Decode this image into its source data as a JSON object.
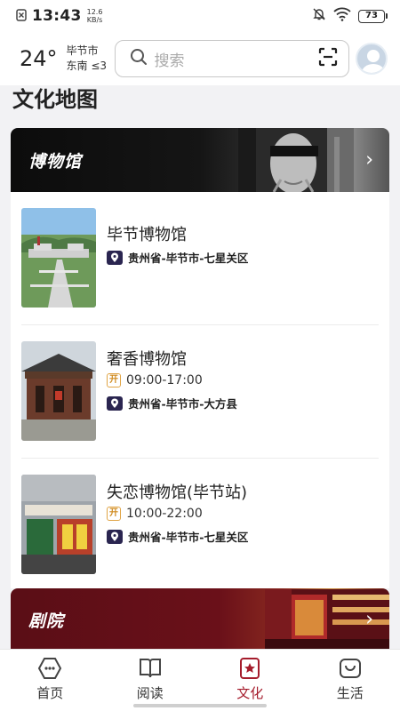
{
  "status_bar": {
    "time": "13:43",
    "net_speed_value": "12.6",
    "net_speed_unit": "KB/s",
    "battery": "73"
  },
  "header": {
    "temperature": "24°",
    "city": "毕节市",
    "wind": "东南 ≤3",
    "search_placeholder": "搜索"
  },
  "page": {
    "title": "文化地图"
  },
  "sections": [
    {
      "title": "博物馆",
      "items": [
        {
          "name": "毕节博物馆",
          "hours": "",
          "address": "贵州省-毕节市-七星关区"
        },
        {
          "name": "奢香博物馆",
          "hours": "09:00-17:00",
          "address": "贵州省-毕节市-大方县"
        },
        {
          "name": "失恋博物馆(毕节站)",
          "hours": "10:00-22:00",
          "address": "贵州省-毕节市-七星关区"
        }
      ]
    },
    {
      "title": "剧院"
    }
  ],
  "open_badge": "开",
  "tabs": [
    {
      "label": "首页"
    },
    {
      "label": "阅读"
    },
    {
      "label": "文化"
    },
    {
      "label": "生活"
    }
  ],
  "colors": {
    "accent": "#a51c2c",
    "pin_badge": "#2a2550",
    "open_badge": "#d08a1e"
  }
}
